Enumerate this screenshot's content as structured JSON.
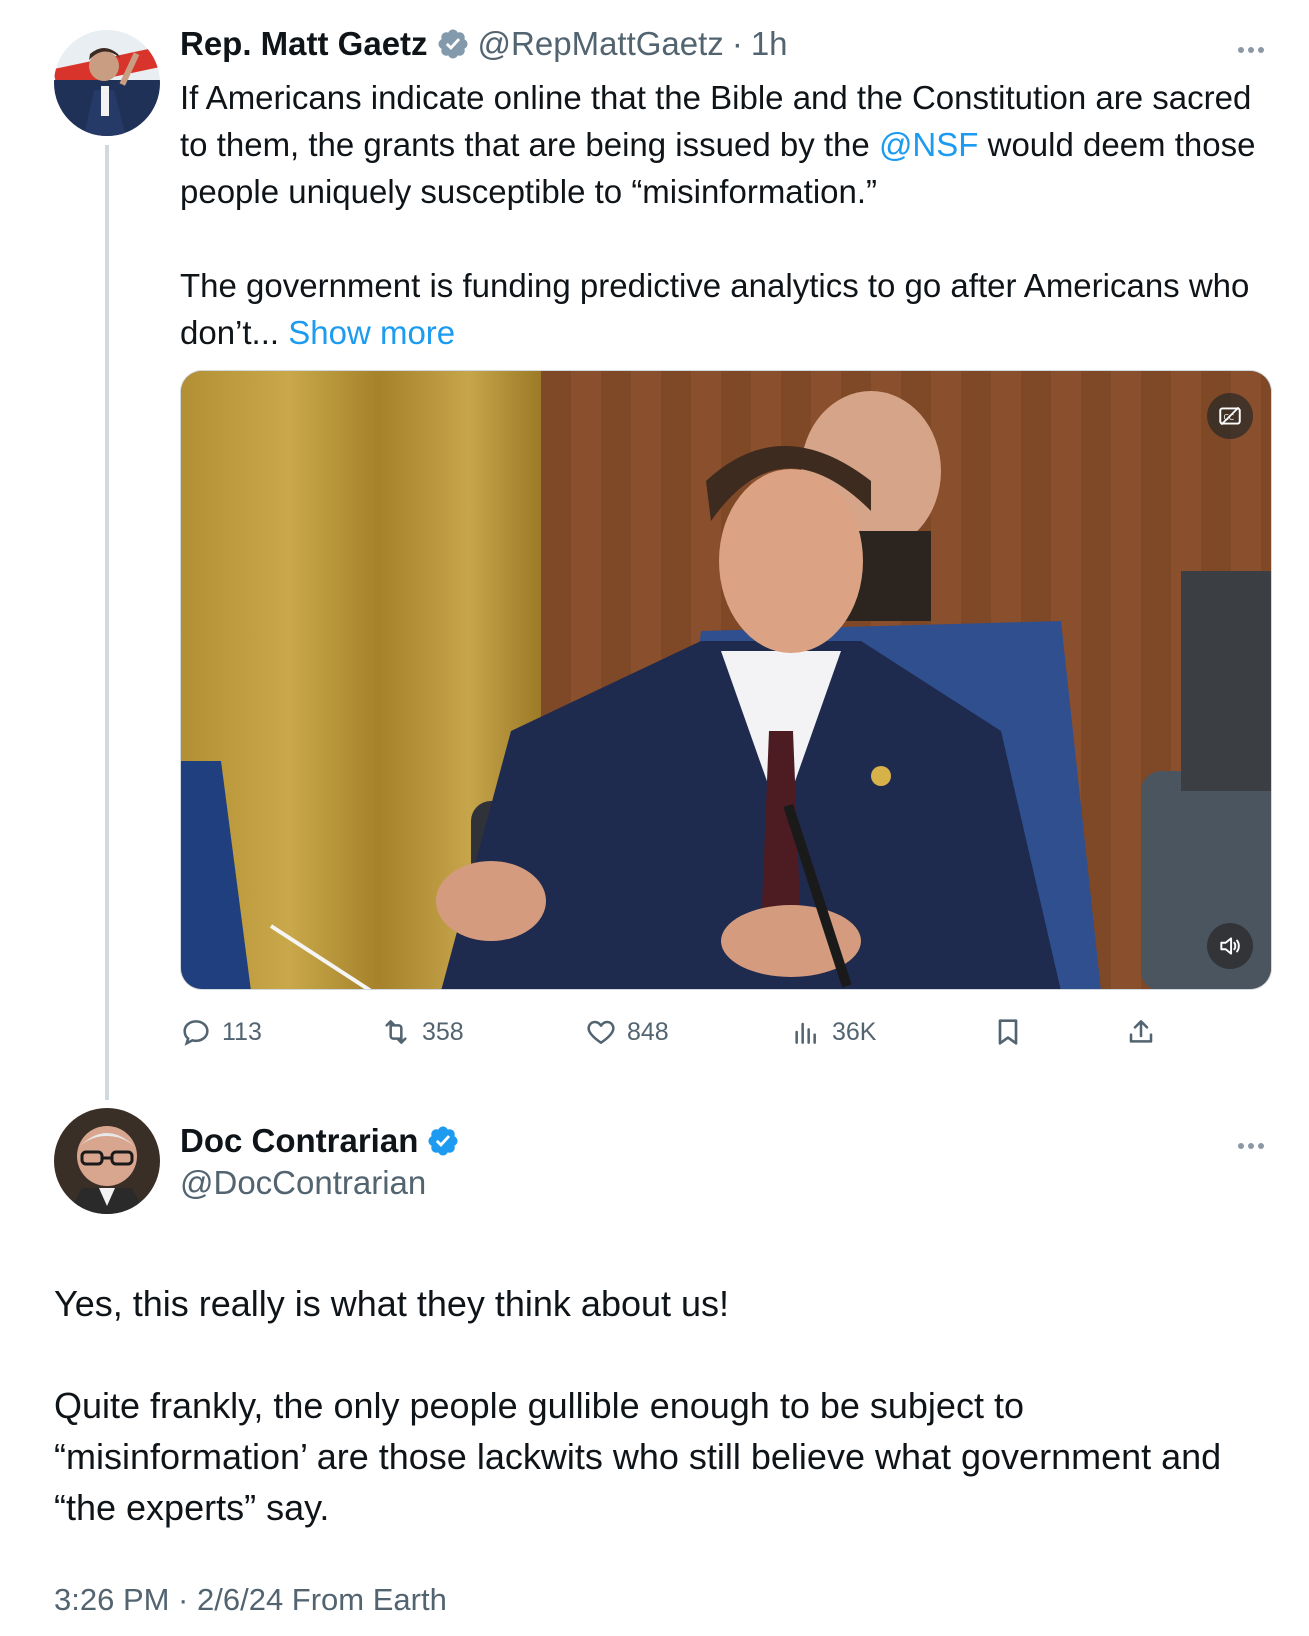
{
  "tweet1": {
    "author_name": "Rep. Matt Gaetz",
    "handle": "@RepMattGaetz",
    "separator": "·",
    "time": "1h",
    "verified_badge": "gray-verified-icon",
    "text_line1_before": "If Americans indicate online that the Bible and the Constitution are sacred to them, the grants that are being issued by the ",
    "mention": "@NSF",
    "text_line1_after": " would deem those people uniquely susceptible to “misinformation.”",
    "text_paragraph2": "The government is funding predictive analytics to go after Americans who don’t...",
    "show_more": "Show more",
    "media_type": "video",
    "actions": {
      "replies": "113",
      "reposts": "358",
      "likes": "848",
      "views": "36K"
    }
  },
  "tweet2": {
    "author_name": "Doc Contrarian",
    "handle": "@DocContrarian",
    "verified_badge": "blue-verified-icon",
    "paragraph1": "Yes, this really is what they think about us!",
    "paragraph2": "Quite frankly, the only people gullible enough to be subject to “misinformation’ are those lackwits who still believe what government and “the experts” say.",
    "timestamp": "3:26 PM · 2/6/24 From Earth"
  },
  "colors": {
    "accent": "#1d9bf0",
    "text": "#0f1419",
    "secondary": "#536471",
    "verified_gray": "#829aab",
    "verified_blue": "#1d9bf0"
  }
}
